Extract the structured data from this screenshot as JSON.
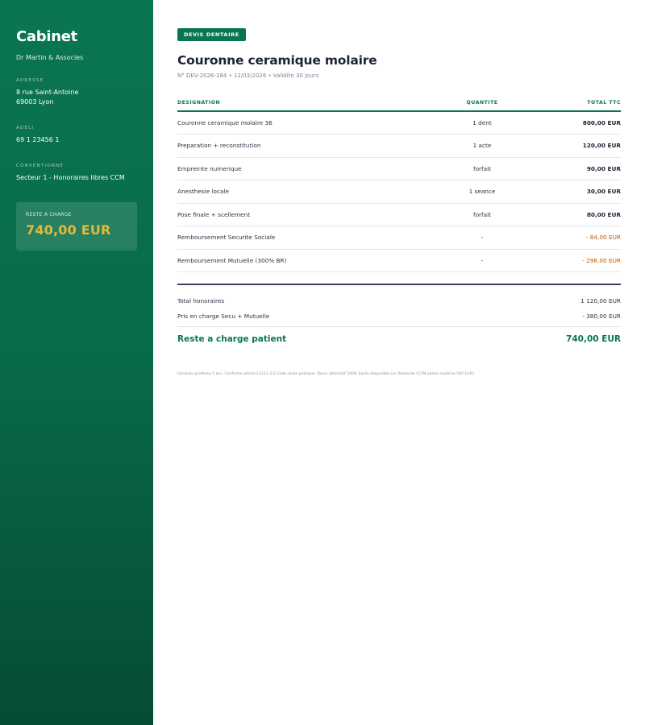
{
  "sidebar": {
    "brand": "Cabinet",
    "practice": "Dr Martin & Associes",
    "address_label": "ADRESSE",
    "address_line1": "8 rue Saint-Antoine",
    "address_line2": "69003 Lyon",
    "adeli_label": "ADELI",
    "adeli_value": "69 1 23456 1",
    "convention_label": "CONVENTIONNE",
    "convention_value": "Secteur 1 - Honoraires libres CCM",
    "due_label": "RESTE A CHARGE",
    "due_amount": "740,00 EUR"
  },
  "document": {
    "badge": "DEVIS DENTAIRE",
    "title": "Couronne ceramique molaire",
    "meta": "N° DEV-2026-184 • 12/03/2026 • Validite 30 jours"
  },
  "table": {
    "headers": {
      "designation": "DESIGNATION",
      "quantite": "QUANTITE",
      "total": "TOTAL TTC"
    },
    "rows": [
      {
        "designation": "Couronne ceramique molaire 36",
        "quantite": "1 dent",
        "total": "800,00 EUR"
      },
      {
        "designation": "Preparation + reconstitution",
        "quantite": "1 acte",
        "total": "120,00 EUR"
      },
      {
        "designation": "Empreinte numerique",
        "quantite": "forfait",
        "total": "90,00 EUR"
      },
      {
        "designation": "Anesthesie locale",
        "quantite": "1 seance",
        "total": "30,00 EUR"
      },
      {
        "designation": "Pose finale + scellement",
        "quantite": "forfait",
        "total": "80,00 EUR"
      },
      {
        "designation": "Remboursement Securite Sociale",
        "quantite": "-",
        "total": "- 84,00 EUR"
      },
      {
        "designation": "Remboursement Mutuelle (300% BR)",
        "quantite": "-",
        "total": "- 296,00 EUR"
      }
    ]
  },
  "summary": {
    "total_label": "Total honoraires",
    "total_value": "1 120,00 EUR",
    "covered_label": "Pris en charge Secu + Mutuelle",
    "covered_value": "- 380,00 EUR",
    "patient_label": "Reste a charge patient",
    "patient_value": "740,00 EUR"
  },
  "footnote": "Garantie prothese 5 ans. Conforme article L1111-3-2 Code sante publique. Devis alternatif 100% Sante disponible sur demande (CCM panier maitrise 500 EUR).",
  "colors": {
    "brand_green": "#0a7650",
    "accent_gold": "#e5b93a",
    "refund_orange": "#b65a0c"
  }
}
